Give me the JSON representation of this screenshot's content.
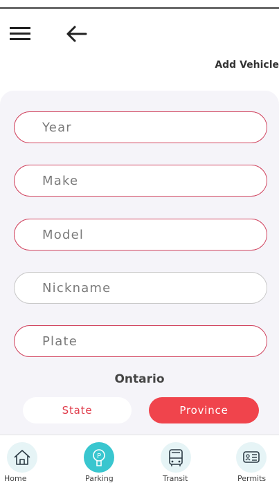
{
  "header": {
    "title": "Add Vehicle",
    "menu_icon": "hamburger-menu-icon",
    "back_icon": "arrow-left-icon"
  },
  "form": {
    "year_placeholder": "Year",
    "make_placeholder": "Make",
    "model_placeholder": "Model",
    "nickname_placeholder": "Nickname",
    "plate_placeholder": "Plate"
  },
  "region": {
    "selected_label": "Ontario",
    "state_label": "State",
    "province_label": "Province",
    "active": "Province"
  },
  "bottom_nav": {
    "items": [
      {
        "label": "Home",
        "icon": "home-icon"
      },
      {
        "label": "Parking",
        "icon": "parking-meter-icon"
      },
      {
        "label": "Transit",
        "icon": "bus-icon"
      },
      {
        "label": "Permits",
        "icon": "permit-card-icon"
      }
    ],
    "active": "Parking"
  },
  "colors": {
    "accent_red": "#f0444c",
    "border_red": "#d1445f",
    "active_teal": "#39c6cf",
    "card_bg": "#f5f4f9"
  }
}
